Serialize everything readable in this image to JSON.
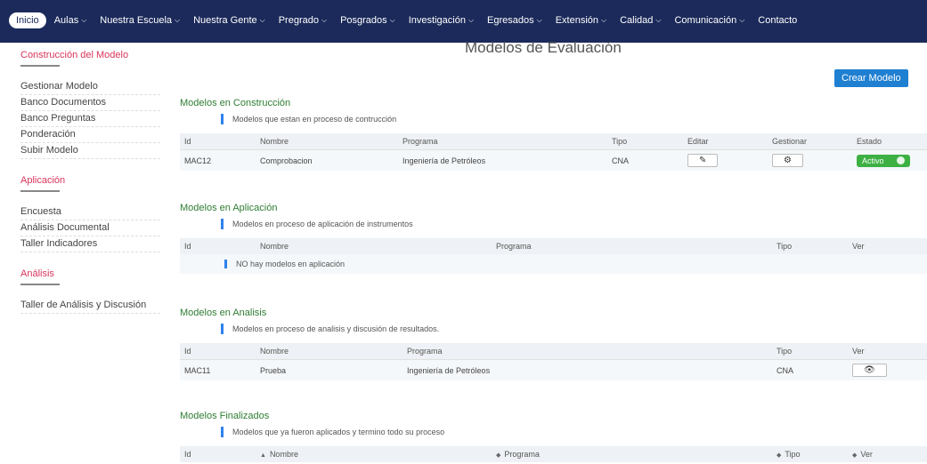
{
  "nav": {
    "items": [
      {
        "label": "Inicio",
        "active": true,
        "caret": false
      },
      {
        "label": "Aulas",
        "active": false,
        "caret": true
      },
      {
        "label": "Nuestra Escuela",
        "active": false,
        "caret": true
      },
      {
        "label": "Nuestra Gente",
        "active": false,
        "caret": true
      },
      {
        "label": "Pregrado",
        "active": false,
        "caret": true
      },
      {
        "label": "Posgrados",
        "active": false,
        "caret": true
      },
      {
        "label": "Investigación",
        "active": false,
        "caret": true
      },
      {
        "label": "Egresados",
        "active": false,
        "caret": true
      },
      {
        "label": "Extensión",
        "active": false,
        "caret": true
      },
      {
        "label": "Calidad",
        "active": false,
        "caret": true
      },
      {
        "label": "Comunicación",
        "active": false,
        "caret": true
      },
      {
        "label": "Contacto",
        "active": false,
        "caret": false
      }
    ]
  },
  "sidebar": {
    "groups": [
      {
        "title": "Construcción del Modelo",
        "items": [
          "Gestionar Modelo",
          "Banco Documentos",
          "Banco Preguntas",
          "Ponderación",
          "Subir Modelo"
        ]
      },
      {
        "title": "Aplicación",
        "items": [
          "Encuesta",
          "Análisis Documental",
          "Taller Indicadores"
        ]
      },
      {
        "title": "Análisis",
        "items": [
          "Taller de Análisis y Discusión"
        ]
      }
    ]
  },
  "page": {
    "title": "Modelos de Evaluación",
    "create_button": "Crear Modelo"
  },
  "sections": {
    "construccion": {
      "title": "Modelos en Construcción",
      "description": "Modelos que estan en proceso de contrucción",
      "headers": [
        "Id",
        "Nombre",
        "Programa",
        "Tipo",
        "Editar",
        "Gestionar",
        "Estado"
      ],
      "rows": [
        {
          "id": "MAC12",
          "nombre": "Comprobacion",
          "programa": "Ingeniería de Petróleos",
          "tipo": "CNA",
          "estado": "Activo"
        }
      ]
    },
    "aplicacion": {
      "title": "Modelos en Aplicación",
      "description": "Modelos en proceso de aplicación de instrumentos",
      "headers": [
        "Id",
        "Nombre",
        "Programa",
        "Tipo",
        "Ver"
      ],
      "empty": "NO hay modelos en aplicación"
    },
    "analisis": {
      "title": "Modelos en Analisis",
      "description": "Modelos en proceso de analisis y discusión de resultados.",
      "headers": [
        "Id",
        "Nombre",
        "Programa",
        "Tipo",
        "Ver"
      ],
      "rows": [
        {
          "id": "MAC11",
          "nombre": "Prueba",
          "programa": "Ingeniería de Petróleos",
          "tipo": "CNA"
        }
      ]
    },
    "finalizados": {
      "title": "Modelos Finalizados",
      "description": "Modelos que ya fueron aplicados y termino todo su proceso",
      "headers": [
        "Id",
        "Nombre",
        "Programa",
        "Tipo",
        "Ver"
      ]
    }
  },
  "icons": {
    "caret": "chevron-down-icon",
    "edit": "pencil-icon",
    "manage": "gear-icon",
    "view": "eye-icon",
    "sort": "sort-icon"
  },
  "colors": {
    "nav_bg": "#1b2a5a",
    "accent_red": "#d9345a",
    "section_green": "#2e7d32",
    "primary_blue": "#1f7fd1",
    "status_green": "#3cb043"
  }
}
